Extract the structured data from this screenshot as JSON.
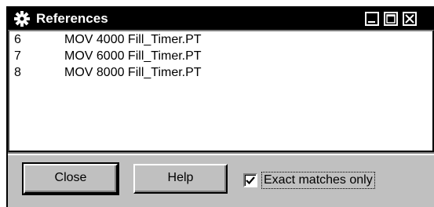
{
  "window": {
    "title": "References",
    "icon": "gear-icon",
    "controls": {
      "minimize": "minimize-icon",
      "maximize": "maximize-icon",
      "close": "close-icon"
    }
  },
  "references": [
    {
      "line": "6",
      "text": "MOV 4000 Fill_Timer.PT"
    },
    {
      "line": "7",
      "text": "MOV 6000 Fill_Timer.PT"
    },
    {
      "line": "8",
      "text": "MOV 8000 Fill_Timer.PT"
    }
  ],
  "buttons": {
    "close_label": "Close",
    "help_label": "Help"
  },
  "options": {
    "exact_matches_label": "Exact matches only",
    "exact_matches_checked": true
  },
  "colors": {
    "titlebar": "#000000",
    "face": "#c0c0c0",
    "list_background": "#ffffff"
  }
}
